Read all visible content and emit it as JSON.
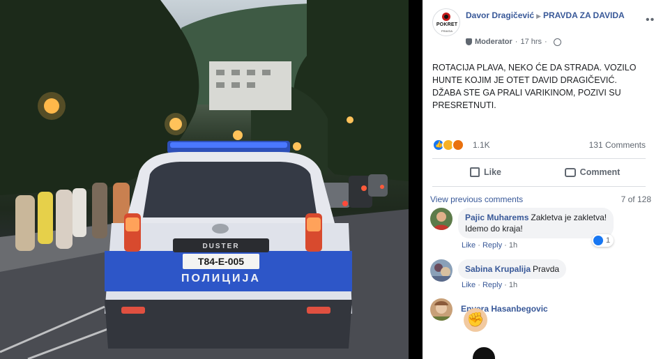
{
  "photo": {
    "plate": "T84-E-005",
    "vehicle_text": "ПОЛИЦИЈА",
    "model_badge": "DUSTER"
  },
  "post": {
    "author": "Davor Dragičević",
    "group": "PRAVDA ZA DAVIDA",
    "role": "Moderator",
    "time": "17 hrs",
    "logo_text": "POKRET",
    "logo_sub": "PRAVDA",
    "text": "ROTACIJA PLAVA, NEKO ĆE DA STRADA. VOZILO HUNTE KOJIM JE OTET DAVID DRAGIČEVIĆ. DŽABA STE GA PRALI VARIKINOM, POZIVI SU PRESRETNUTI.",
    "reaction_icons": [
      "like-icon",
      "sad-icon",
      "angry-icon"
    ],
    "reaction_count": "1.1K",
    "comment_count": "131 Comments",
    "like_label": "Like",
    "comment_label": "Comment",
    "view_previous": "View previous comments",
    "comments_position": "7 of 128"
  },
  "comments": [
    {
      "author": "Pajic Muharems",
      "text_line1": "Zakletva je zakletva!",
      "text_line2": "Idemo do kraja!",
      "like": "Like",
      "reply": "Reply",
      "time": "1h",
      "reaction_count": "1"
    },
    {
      "author": "Sabina Krupalija",
      "text_line1": "Pravda",
      "like": "Like",
      "reply": "Reply",
      "time": "1h"
    },
    {
      "author": "Envera Hasanbegovic",
      "sticker": "raised-fist-icon"
    }
  ],
  "colors": {
    "link_blue": "#385898",
    "meta_gray": "#606770",
    "bubble_bg": "#f2f3f5",
    "like_blue": "#1877f2"
  }
}
